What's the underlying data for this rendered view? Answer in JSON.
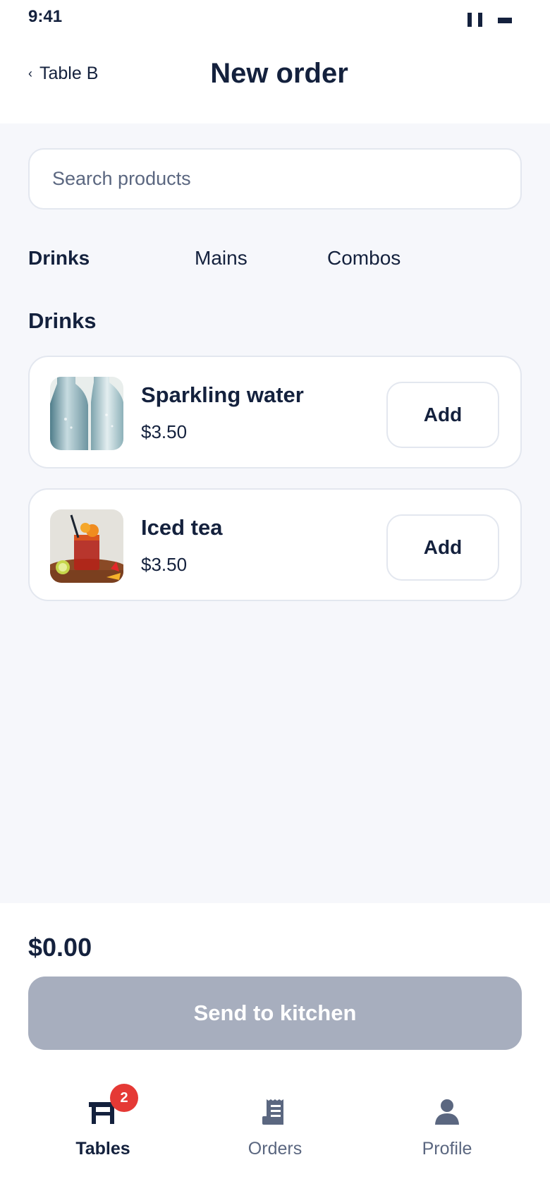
{
  "status_bar": {
    "time": "9:41"
  },
  "header": {
    "back_label": "Table B",
    "title": "New order"
  },
  "search": {
    "placeholder": "Search products",
    "value": ""
  },
  "categories": [
    {
      "label": "Drinks",
      "active": true
    },
    {
      "label": "Mains",
      "active": false
    },
    {
      "label": "Combos",
      "active": false
    }
  ],
  "section": {
    "title": "Drinks"
  },
  "products": [
    {
      "name": "Sparkling water",
      "price": "$3.50",
      "add_label": "Add",
      "image": "sparkling-water-photo"
    },
    {
      "name": "Iced tea",
      "price": "$3.50",
      "add_label": "Add",
      "image": "iced-tea-photo"
    }
  ],
  "summary": {
    "total": "$0.00",
    "send_label": "Send to kitchen",
    "send_enabled": false
  },
  "bottom_nav": [
    {
      "label": "Tables",
      "icon": "table-icon",
      "active": true,
      "badge": "2"
    },
    {
      "label": "Orders",
      "icon": "receipt-icon",
      "active": false
    },
    {
      "label": "Profile",
      "icon": "user-icon",
      "active": false
    }
  ],
  "colors": {
    "primary_text": "#14213d",
    "muted_text": "#5b6780",
    "background": "#f6f7fb",
    "border": "#e3e7ef",
    "disabled_button": "#a7aebe",
    "badge": "#e53935"
  }
}
